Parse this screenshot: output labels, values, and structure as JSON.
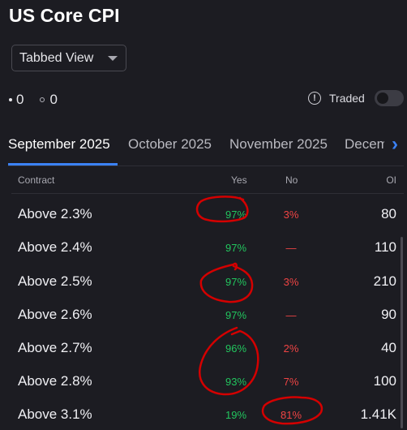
{
  "title": "US Core CPI",
  "view_select": {
    "value": "Tabbed View"
  },
  "counts": {
    "first": "0",
    "second": "0"
  },
  "traded": {
    "label": "Traded",
    "enabled": false
  },
  "tabs": [
    {
      "label": "September 2025",
      "active": true
    },
    {
      "label": "October 2025",
      "active": false
    },
    {
      "label": "November 2025",
      "active": false
    },
    {
      "label": "Decem",
      "active": false
    }
  ],
  "columns": {
    "contract": "Contract",
    "yes": "Yes",
    "no": "No",
    "oi": "OI"
  },
  "rows": [
    {
      "contract": "Above 2.3%",
      "yes": "97%",
      "no": "3%",
      "oi": "80"
    },
    {
      "contract": "Above 2.4%",
      "yes": "97%",
      "no": "—",
      "oi": "110"
    },
    {
      "contract": "Above 2.5%",
      "yes": "97%",
      "no": "3%",
      "oi": "210"
    },
    {
      "contract": "Above 2.6%",
      "yes": "97%",
      "no": "—",
      "oi": "90"
    },
    {
      "contract": "Above 2.7%",
      "yes": "96%",
      "no": "2%",
      "oi": "40"
    },
    {
      "contract": "Above 2.8%",
      "yes": "93%",
      "no": "7%",
      "oi": "100"
    },
    {
      "contract": "Above 3.1%",
      "yes": "19%",
      "no": "81%",
      "oi": "1.41K"
    }
  ],
  "colors": {
    "background": "#1c1c22",
    "accent": "#3b82f6",
    "yes": "#22c55e",
    "no": "#ef4444",
    "annotation": "#d40000"
  },
  "icons": {
    "info": "info-circle-icon",
    "next_tab": "chevron-right-icon",
    "dropdown": "caret-down-icon"
  }
}
